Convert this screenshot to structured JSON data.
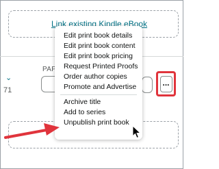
{
  "link_ebook": {
    "label": "Link existing Kindle eBook"
  },
  "row": {
    "chevron": "⌄",
    "number": "71",
    "paper_label": "PAPE",
    "more_label": "..."
  },
  "menu": {
    "items": [
      "Edit print book details",
      "Edit print book content",
      "Edit print book pricing",
      "Request Printed Proofs",
      "Order author copies",
      "Promote and Advertise"
    ],
    "items_after_divider": [
      "Archive title",
      "Add to series",
      "Unpublish print book"
    ]
  },
  "colors": {
    "link": "#007185",
    "annotation_red": "#e0343c",
    "border": "#9aa0a6"
  }
}
